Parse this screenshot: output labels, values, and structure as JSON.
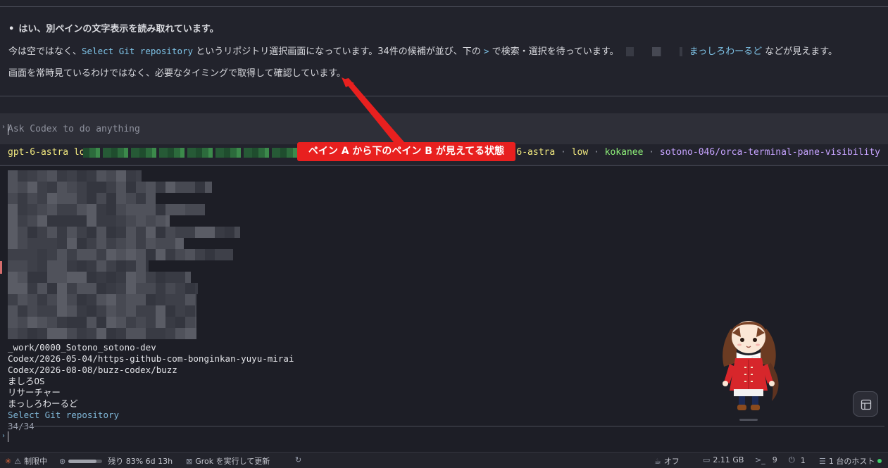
{
  "pane_a": {
    "message": {
      "line1": "はい、別ペインの文字表示を読み取れています。",
      "line2_prefix": "今は空ではなく、",
      "line2_code": "Select Git repository",
      "line2_mid": " というリポジトリ選択画面になっています。34件の候補が並び、下の ",
      "line2_gt": ">",
      "line2_mid2": " で検索・選択を待っています。",
      "line2_name": "まっしろわーるど",
      "line2_suffix": " などが見えます。",
      "line3": "画面を常時見ているわけではなく、必要なタイミングで取得して確認しています。"
    },
    "composer": {
      "placeholder": "Ask Codex to do anything"
    },
    "statusline": {
      "model": "gpt-6-astra",
      "effort": "low",
      "right_fragment": "e",
      "right_model": "gpt-6-astra",
      "right_effort": "low",
      "right_user": "kokanee",
      "right_branch": "sotono-046/orca-terminal-pane-visibility",
      "separator": "·"
    }
  },
  "annotation": {
    "callout": "ペイン A から下のペイン B が見えてる状態"
  },
  "pane_b": {
    "repo_list": [
      "_work/0000_Sotono_sotono-dev",
      "Codex/2026-05-04/https-github-com-bonginkan-yuyu-mirai",
      "Codex/2026-08-08/buzz-codex/buzz",
      "ましろOS",
      "リサーチャー",
      "まっしろわーるど"
    ],
    "selected": "Select Git repository",
    "count": "34/34"
  },
  "bottombar": {
    "limit": "制限中",
    "remaining": "残り 83% 6d 13h",
    "usage_fraction": 0.83,
    "grok": "Grok を実行して更新",
    "off": "オフ",
    "memory": "2.11 GB",
    "terminals": "9",
    "plugs": "1",
    "hosts": "1 台のホスト",
    "icons": [
      "warning-icon",
      "openai-icon",
      "grok-icon",
      "refresh-icon",
      "mug-icon",
      "memory-icon",
      "terminal-icon",
      "plug-icon",
      "server-icon"
    ],
    "accent": "#3fd16b"
  }
}
